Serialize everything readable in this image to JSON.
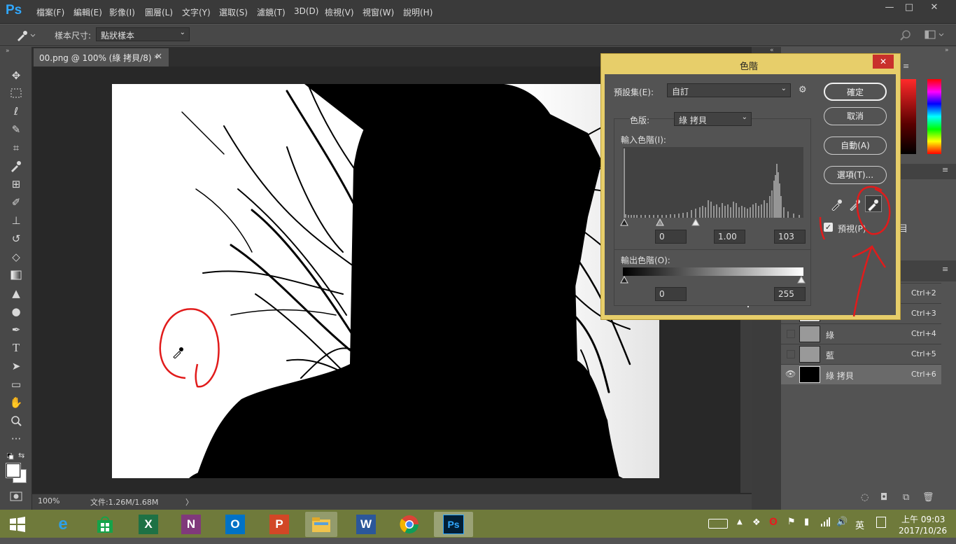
{
  "app": {
    "logo": "Ps"
  },
  "menu": [
    "檔案(F)",
    "編輯(E)",
    "影像(I)",
    "圖層(L)",
    "文字(Y)",
    "選取(S)",
    "濾鏡(T)",
    "3D(D)",
    "檢視(V)",
    "視窗(W)",
    "說明(H)"
  ],
  "window_controls": {
    "minimize": "—",
    "restore": "□",
    "close": "✕"
  },
  "options": {
    "sample_label": "樣本尺寸:",
    "sample_value": "點狀樣本"
  },
  "document": {
    "tab_title": "00.png @ 100% (綠 拷貝/8) *",
    "tab_close": "×"
  },
  "status": {
    "zoom": "100%",
    "doc_info": "文件:1.26M/1.68M",
    "arrow": "〉"
  },
  "levels_dialog": {
    "title": "色階",
    "preset_label": "預設集(E):",
    "preset_value": "自訂",
    "channel_label": "色版:",
    "channel_value": "綠 拷貝",
    "input_label": "輸入色階(I):",
    "input_values": [
      "0",
      "1.00",
      "103"
    ],
    "output_label": "輸出色階(O):",
    "output_values": [
      "0",
      "255"
    ],
    "buttons": {
      "ok": "確定",
      "cancel": "取消",
      "auto": "自動(A)",
      "options": "選項(T)..."
    },
    "preview_label": "預視(P)",
    "preview_checked": true
  },
  "layers": [
    {
      "name": "",
      "shortcut": "Ctrl+2"
    },
    {
      "name": "",
      "shortcut": "Ctrl+3"
    },
    {
      "name": "綠",
      "shortcut": "Ctrl+4"
    },
    {
      "name": "藍",
      "shortcut": "Ctrl+5"
    },
    {
      "name": "綠 拷貝",
      "shortcut": "Ctrl+6"
    }
  ],
  "taskbar": {
    "icons": [
      "windows-start",
      "internet-explorer",
      "store",
      "excel",
      "onenote",
      "outlook",
      "powerpoint",
      "file-explorer",
      "word",
      "chrome",
      "photoshop"
    ],
    "tray_lang": "英",
    "time": "上午 09:03",
    "date": "2017/10/26"
  },
  "colors": {
    "accent": "#31a8ff",
    "dialog_title_bar": "#e7ce6a",
    "annotation": "#e11b1b",
    "close_red": "#c9302c"
  }
}
